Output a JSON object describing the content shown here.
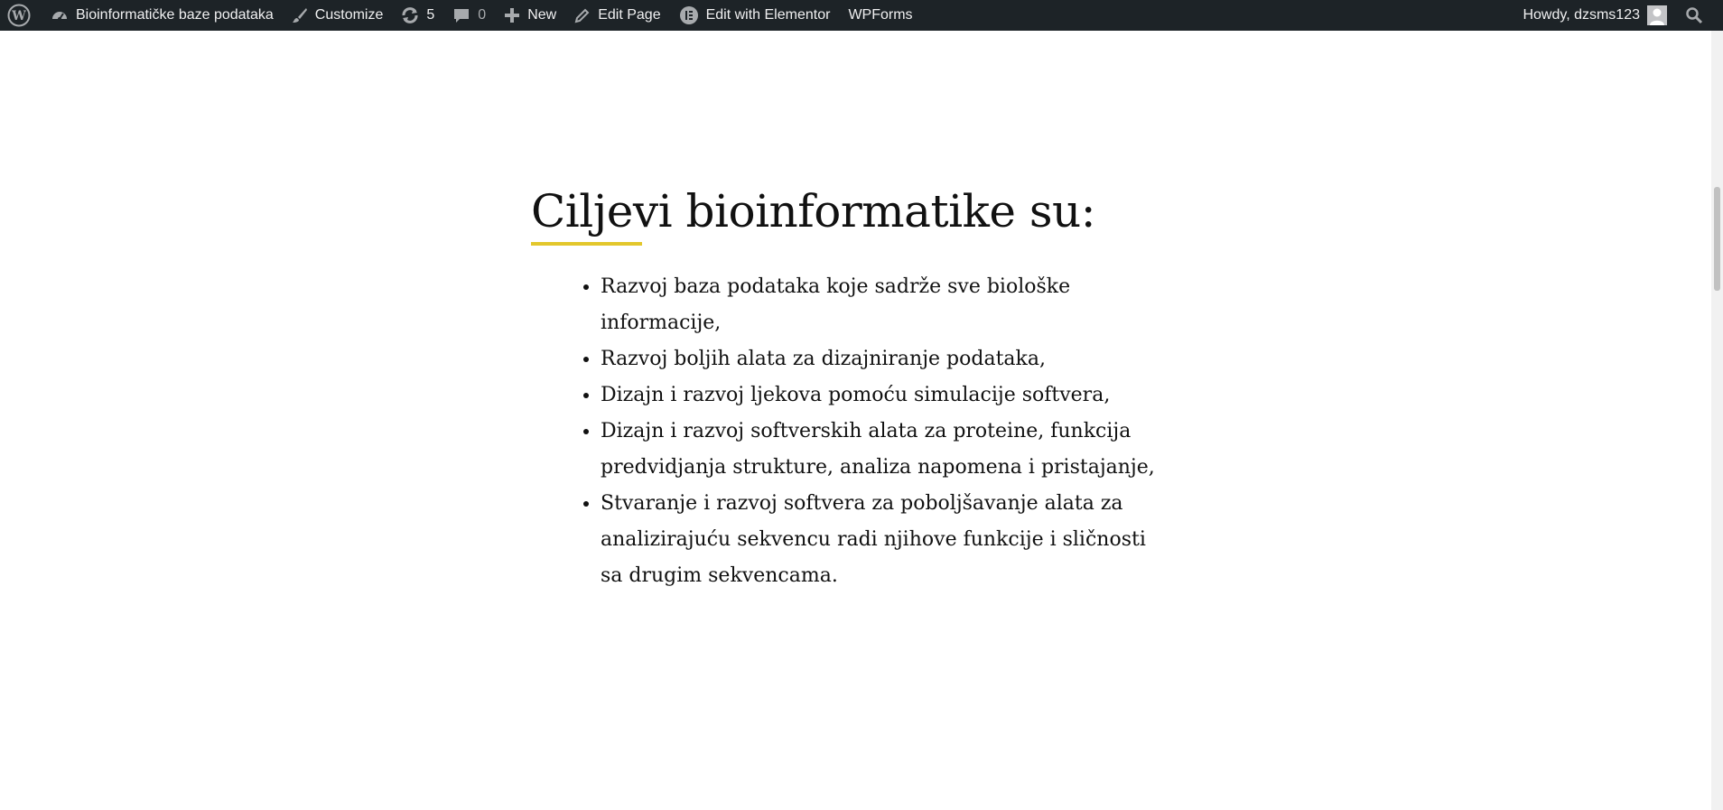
{
  "adminbar": {
    "wp_logo": "wordpress-logo",
    "site_name": "Bioinformatičke baze podataka",
    "customize": "Customize",
    "updates_count": "5",
    "comments_count": "0",
    "new": "New",
    "edit_page": "Edit Page",
    "edit_elementor": "Edit with Elementor",
    "wpforms": "WPForms",
    "howdy": "Howdy, dzsms123",
    "colors": {
      "bar": "#1d2327",
      "text": "#f0f0f1",
      "muted": "#a7aaad"
    }
  },
  "main": {
    "heading": "Ciljevi bioinformatike su:",
    "accent_color": "#e3c72c",
    "goals": [
      "Razvoj baza podataka koje sadrže sve biološke informacije,",
      "Razvoj boljih alata za dizajniranje podataka,",
      "Dizajn i razvoj ljekova pomoću simulacije softvera,",
      "Dizajn i razvoj softverskih alata za proteine, funkcija predvidjanja strukture, analiza napomena i pristajanje,",
      "Stvaranje i razvoj softvera za poboljšavanje alata za analizirajuću sekvencu radi njihove funkcije i sličnosti sa drugim sekvencama."
    ]
  }
}
